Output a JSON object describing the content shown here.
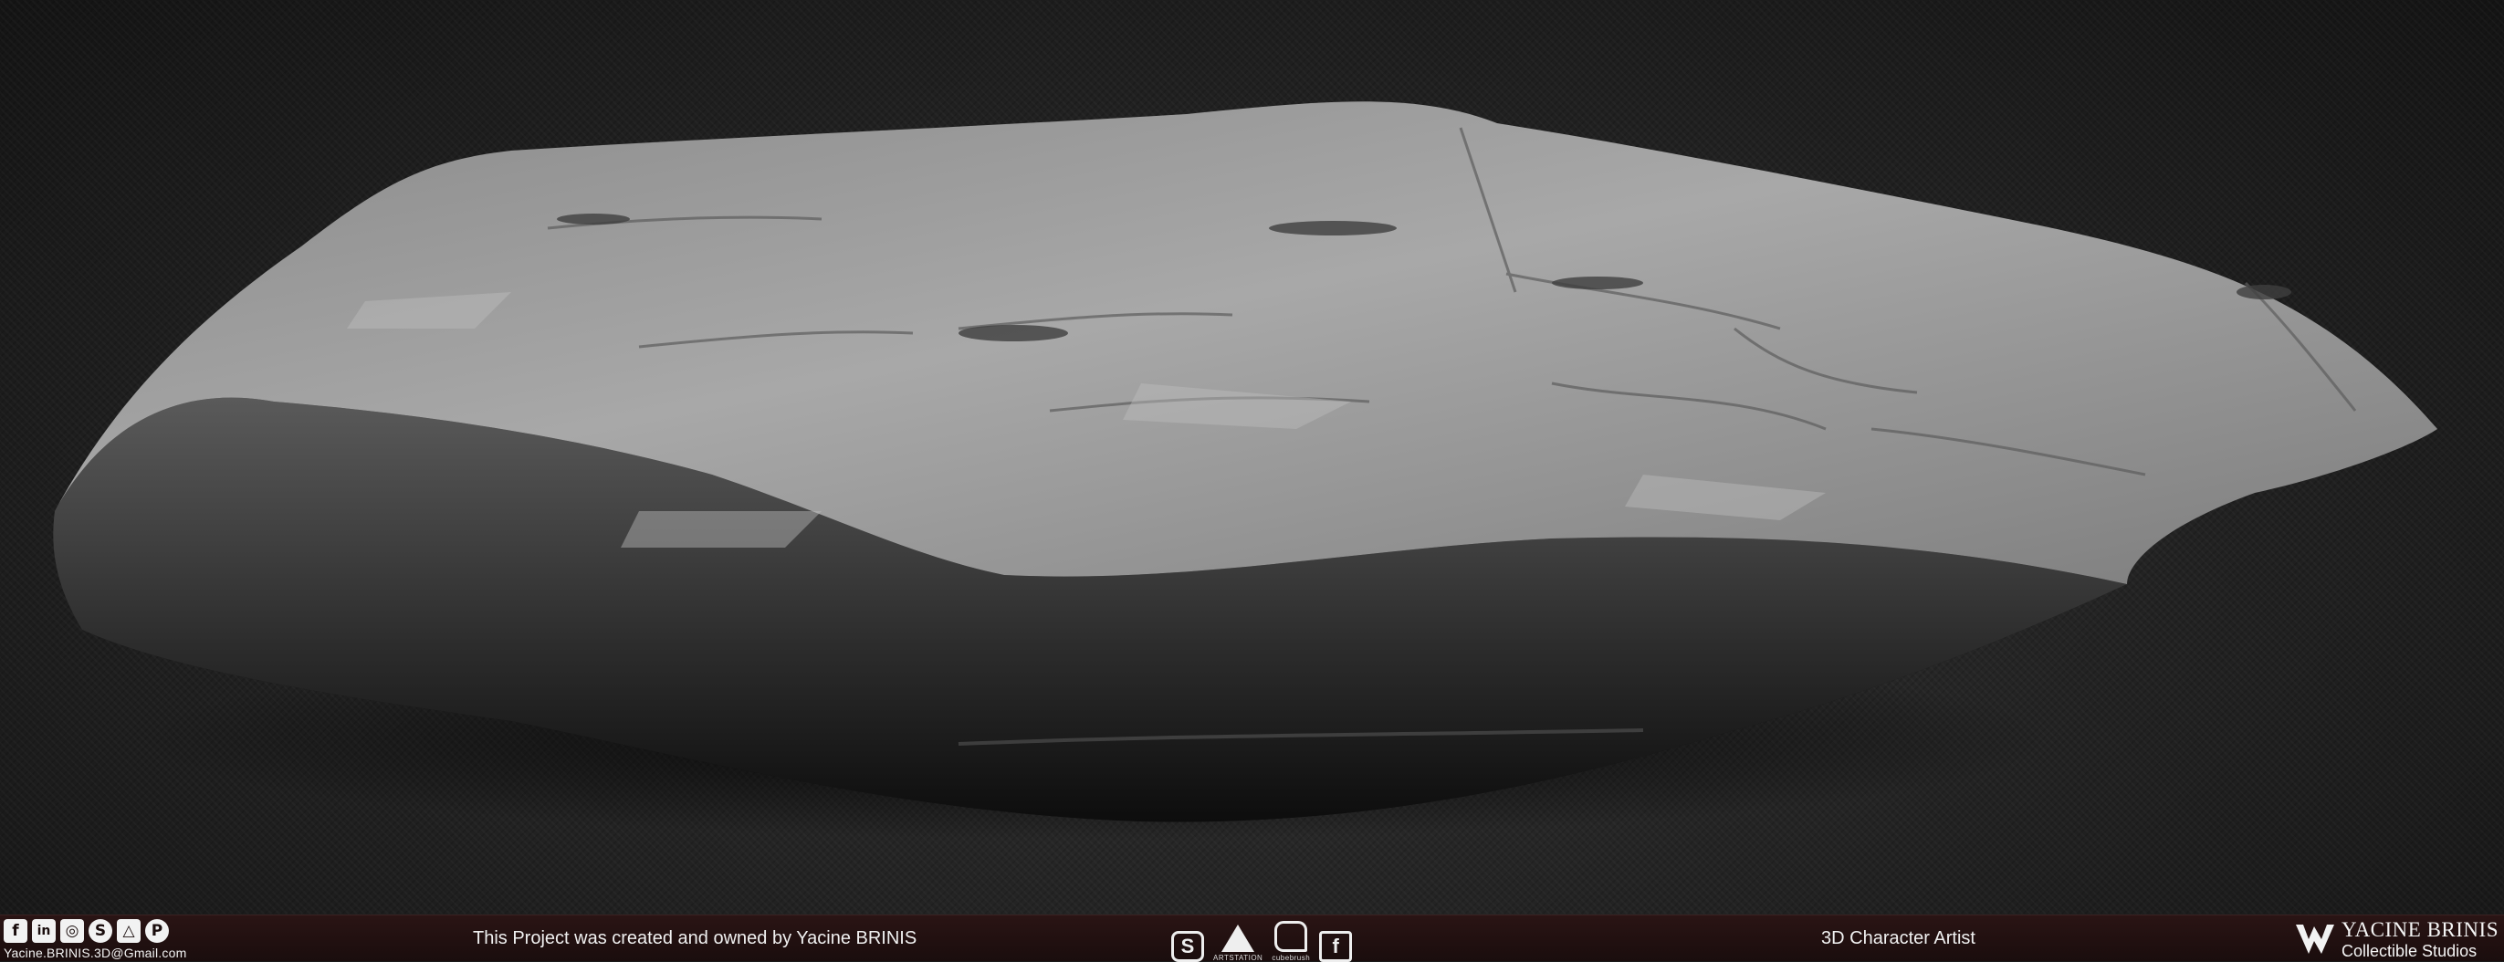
{
  "scene": {
    "subject": "rock-sculpt-render"
  },
  "footer": {
    "social_icons": [
      "facebook-icon",
      "linkedin-icon",
      "instagram-icon",
      "skype-icon",
      "artstation-icon",
      "pinterest-icon"
    ],
    "social_glyphs": [
      "f",
      "in",
      "◎",
      "S",
      "△",
      "P"
    ],
    "email": "Yacine.BRINIS.3D@Gmail.com",
    "credit": "This Project was created and owned by Yacine BRINIS",
    "tools": [
      {
        "icon": "substance-icon",
        "glyph": "S",
        "caption": ""
      },
      {
        "icon": "artstation-logo-icon",
        "glyph": "",
        "caption": "ARTSTATION"
      },
      {
        "icon": "cubebrush-icon",
        "glyph": "",
        "caption": "cubebrush"
      },
      {
        "icon": "gumroad-icon",
        "glyph": "f",
        "caption": ""
      }
    ],
    "role": "3D Character Artist",
    "brand_name": "YACINE BRINIS",
    "brand_sub": "Collectible Studios"
  }
}
